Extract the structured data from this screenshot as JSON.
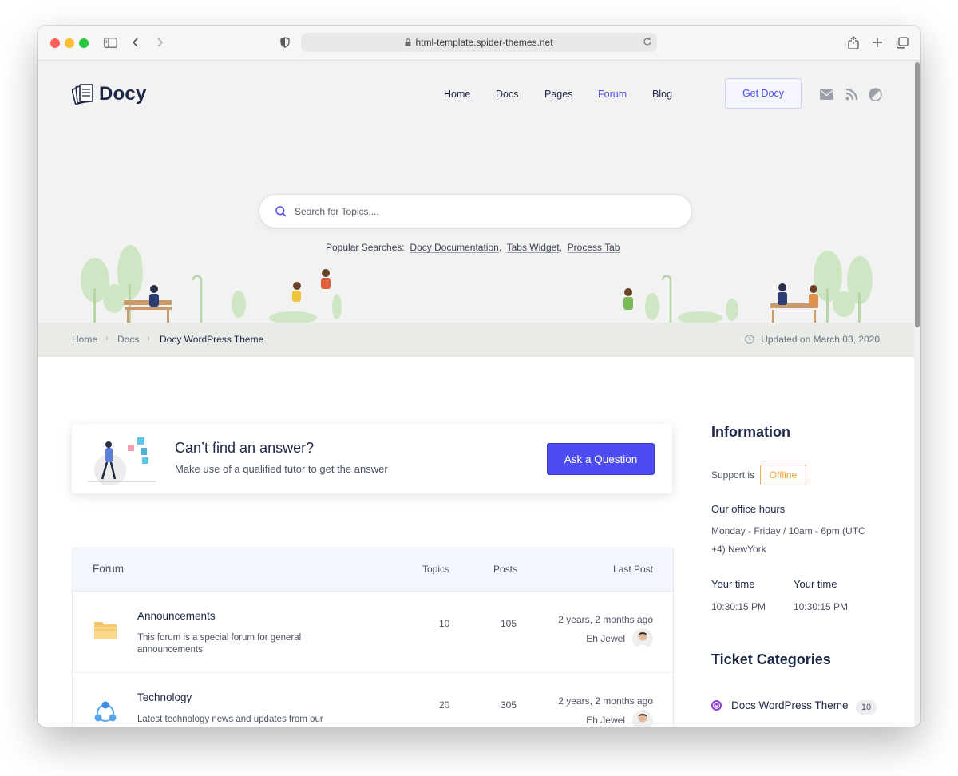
{
  "browser": {
    "url": "html-template.spider-themes.net"
  },
  "header": {
    "logo": "Docy",
    "nav": [
      "Home",
      "Docs",
      "Pages",
      "Forum",
      "Blog"
    ],
    "cta": "Get Docy",
    "active_color": "#4c4cf1"
  },
  "hero": {
    "search_placeholder": "Search for Topics....",
    "popular_label": "Popular Searches:",
    "popular": [
      "Docy Documentation",
      "Tabs Widget",
      "Process Tab"
    ]
  },
  "breadcrumb": {
    "items": [
      "Home",
      "Docs"
    ],
    "current": "Docy WordPress Theme",
    "updated": "Updated on March 03, 2020"
  },
  "cta": {
    "title": "Can’t find an answer?",
    "subtitle": "Make use of a qualified tutor to get the answer",
    "button": "Ask a Question"
  },
  "forum": {
    "columns": [
      "Forum",
      "Topics",
      "Posts",
      "Last Post"
    ],
    "rows": [
      {
        "title": "Announcements",
        "desc": "This forum is a special forum for general announcements.",
        "topics": "10",
        "posts": "105",
        "ago": "2 years, 2 months ago",
        "author": "Eh Jewel",
        "icon": "folder-icon"
      },
      {
        "title": "Technology",
        "desc": "Latest technology news and updates from our",
        "topics": "20",
        "posts": "305",
        "ago": "2 years, 2 months ago",
        "author": "Eh Jewel",
        "icon": "network-icon"
      }
    ]
  },
  "sidebar": {
    "info_title": "Information",
    "support_label": "Support is",
    "support_status": "Offline",
    "hours_title": "Our office hours",
    "hours_line1": "Monday - Friday / 10am - 6pm (UTC",
    "hours_line2": "+4) NewYork",
    "your_time_label": "Your time",
    "your_time_1": "10:30:15 PM",
    "your_time_2": "10:30:15 PM",
    "tickets_title": "Ticket Categories",
    "category": "Docs WordPress Theme",
    "category_count": "10"
  }
}
